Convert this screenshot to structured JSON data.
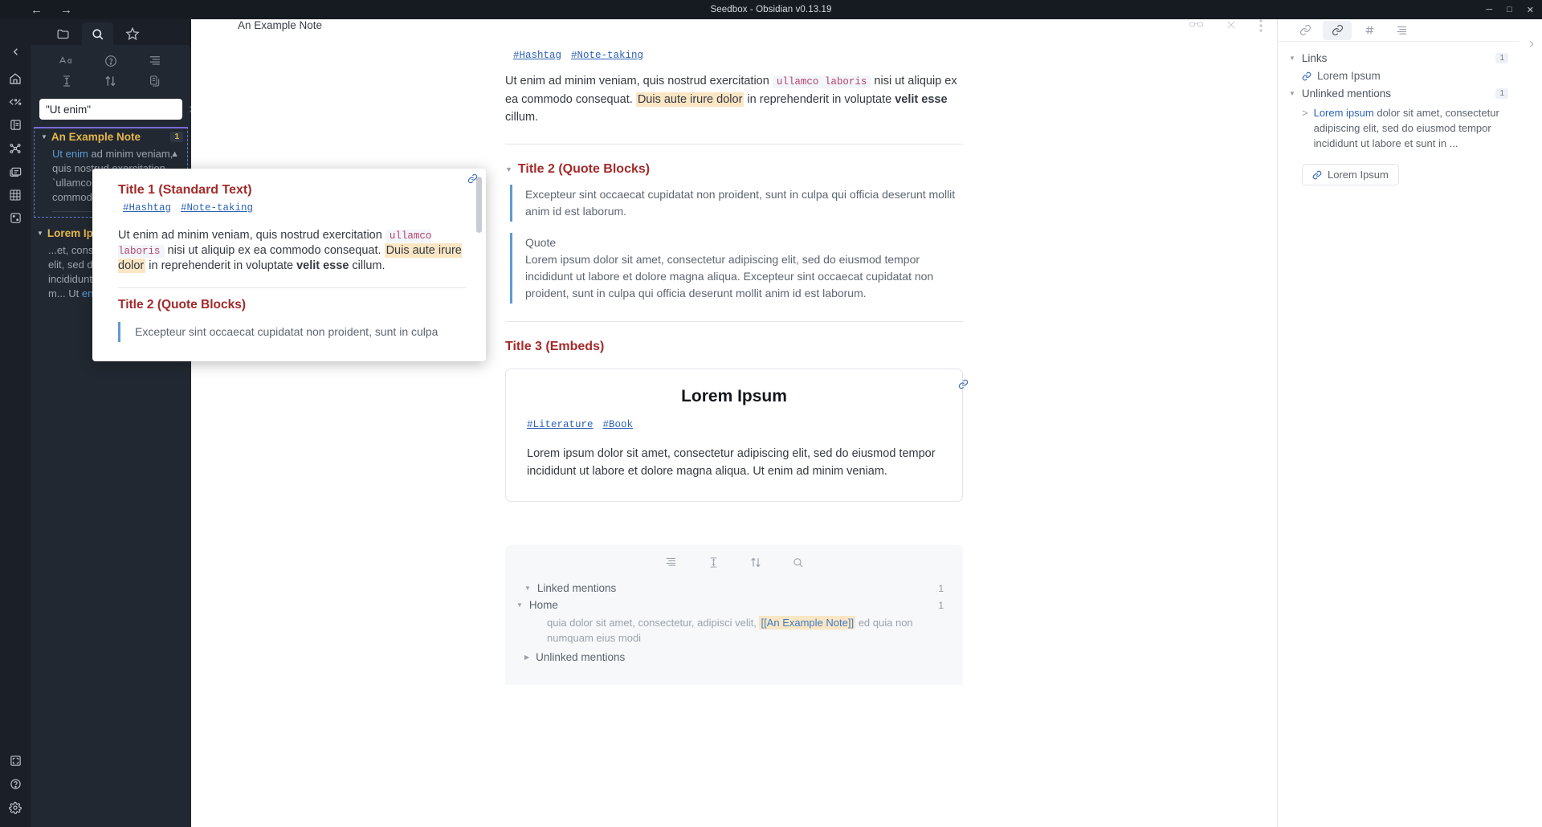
{
  "window": {
    "title": "Seedbox - Obsidian v0.13.19",
    "back_icon": "←",
    "forward_icon": "→",
    "minimize": "─",
    "maximize": "□",
    "close": "✕"
  },
  "ribbon": {
    "items": [
      {
        "name": "collapse-left-icon",
        "label": "Collapse"
      },
      {
        "name": "home-icon",
        "label": "Home"
      },
      {
        "name": "code-percent-icon",
        "label": "Templater"
      },
      {
        "name": "note-composer-icon",
        "label": "Note composer"
      },
      {
        "name": "graph-view-icon",
        "label": "Graph view"
      },
      {
        "name": "card-stack-icon",
        "label": "Card board"
      },
      {
        "name": "grid-icon",
        "label": "Dataview"
      },
      {
        "name": "dice-icon",
        "label": "Random note"
      }
    ],
    "bottom": [
      {
        "name": "screenshot-icon",
        "label": "Capture"
      },
      {
        "name": "help-icon",
        "label": "Help"
      },
      {
        "name": "settings-icon",
        "label": "Settings"
      }
    ]
  },
  "sidebar": {
    "tabs": [
      {
        "name": "files-tab",
        "label": "Files"
      },
      {
        "name": "search-tab",
        "label": "Search"
      },
      {
        "name": "starred-tab",
        "label": "Starred"
      }
    ],
    "active_tab": "search-tab",
    "tools": [
      {
        "name": "match-case-icon",
        "label": "Aa"
      },
      {
        "name": "help-circle-icon",
        "label": "?"
      },
      {
        "name": "explain-search-icon",
        "label": "Explain search term"
      },
      {
        "name": "collapse-results-icon",
        "label": "Collapse results"
      },
      {
        "name": "sort-order-icon",
        "label": "Change sort order"
      },
      {
        "name": "copy-results-icon",
        "label": "Copy search results"
      }
    ],
    "search": {
      "value": "\"Ut enim\"",
      "placeholder": "Search...",
      "clear_icon": "✕"
    },
    "results": [
      {
        "title": "An Example Note",
        "count": "1",
        "selected": true,
        "snippet_pre": "",
        "snippet_hl": "Ut enim",
        "snippet_post": " ad minim veniam, quis nostrud exercitation `ullamco laboris` ea commodo consequat"
      },
      {
        "title": "Lorem Ipsum",
        "count": "",
        "selected": false,
        "snippet_pre": "...et, consectetur adipiscing elit, sed do eiusmod tempor incididunt ut labore et dolore m... Ut ",
        "snippet_hl": "enim",
        "snippet_post": " ad"
      }
    ]
  },
  "editor": {
    "title": "An Example Note",
    "actions": [
      {
        "name": "reading-view-icon",
        "label": "Reading view"
      },
      {
        "name": "close-icon",
        "label": "Close"
      },
      {
        "name": "more-options-icon",
        "label": "More options"
      }
    ],
    "tags": [
      {
        "name": "tag-hashtag",
        "label": "#Hashtag"
      },
      {
        "name": "tag-note-taking",
        "label": "#Note-taking"
      }
    ],
    "paragraph": {
      "part1": "Ut enim ad minim veniam, quis nostrud exercitation ",
      "code": "ullamco laboris",
      "part2": " nisi ut aliquip ex ea commodo consequat. ",
      "mark": "Duis aute irure dolor",
      "part3": " in reprehenderit in voluptate ",
      "bold": "velit esse",
      "part4": " cillum."
    },
    "heading2": "Title 2 (Quote Blocks)",
    "quote1": "Excepteur sint occaecat cupidatat non proident, sunt in culpa qui officia deserunt mollit anim id est laborum.",
    "quote_label": "Quote",
    "quote2": "Lorem ipsum dolor sit amet, consectetur adipiscing elit, sed do eiusmod tempor incididunt ut labore et dolore magna aliqua. Excepteur sint occaecat cupidatat non proident, sunt in culpa qui officia deserunt mollit anim id est laborum.",
    "heading3": "Title 3 (Embeds)",
    "embed": {
      "title": "Lorem Ipsum",
      "link_icon": "link",
      "tags": [
        {
          "name": "tag-literature",
          "label": "#Literature"
        },
        {
          "name": "tag-book",
          "label": "#Book"
        }
      ],
      "body": "Lorem ipsum dolor sit amet, consectetur adipiscing elit, sed do eiusmod tempor incididunt ut labore et dolore magna aliqua. Ut enim ad minim veniam."
    },
    "backlinks": {
      "tools": [
        {
          "name": "collapse-results-icon",
          "label": "Collapse results"
        },
        {
          "name": "show-more-context-icon",
          "label": "Show more context"
        },
        {
          "name": "sort-order-icon",
          "label": "Change sort order"
        },
        {
          "name": "search-backlinks-icon",
          "label": "Search"
        }
      ],
      "linked_label": "Linked mentions",
      "linked_count": "1",
      "file_label": "Home",
      "file_count": "1",
      "snippet_pre": "quia dolor sit amet, consectetur, adipisci velit, ",
      "snippet_link": "[[An Example Note]]",
      "snippet_post": " ed quia non numquam eius modi",
      "unlinked_label": "Unlinked mentions"
    }
  },
  "rightbar": {
    "tabs": [
      {
        "name": "outgoing-links-tab",
        "label": "Outgoing links"
      },
      {
        "name": "backlinks-tab",
        "label": "Backlinks"
      },
      {
        "name": "tags-tab",
        "label": "Tags"
      },
      {
        "name": "outline-tab",
        "label": "Outline"
      }
    ],
    "active_tab": "backlinks-tab",
    "links_label": "Links",
    "links_count": "1",
    "links_items": [
      {
        "name": "link-item-lorem-ipsum",
        "label": "Lorem Ipsum"
      }
    ],
    "unlinked_label": "Unlinked mentions",
    "unlinked_count": "1",
    "unlinked_quote_pre": "",
    "unlinked_quote_link": "Lorem ipsum",
    "unlinked_quote_post": " dolor sit amet, consectetur adipiscing elit, sed do eiusmod tempor incididunt ut labore et sunt in ...",
    "unlinked_chip": "Lorem Ipsum",
    "expand_icon": "›"
  },
  "popup": {
    "heading1": "Title 1 (Standard Text)",
    "tags": [
      {
        "name": "popup-tag-hashtag",
        "label": "#Hashtag"
      },
      {
        "name": "popup-tag-note-taking",
        "label": "#Note-taking"
      }
    ],
    "paragraph": {
      "part1": "Ut enim ad minim veniam, quis nostrud exercitation ",
      "code": "ullamco laboris",
      "part2": " nisi ut aliquip ex ea commodo consequat. ",
      "mark": "Duis aute irure dolor",
      "part3": " in reprehenderit in voluptate ",
      "bold": "velit esse",
      "part4": " cillum."
    },
    "heading2": "Title 2 (Quote Blocks)",
    "quote": "Excepteur sint occaecat cupidatat non proident, sunt in culpa"
  },
  "colors": {
    "chrome": "#161b22",
    "sidebar": "#1b2028",
    "panel": "#222831",
    "accent_yellow": "#e5b84b",
    "accent_blue": "#2d62b4",
    "heading_red": "#a32a2a",
    "highlight": "#fbe6c4"
  }
}
